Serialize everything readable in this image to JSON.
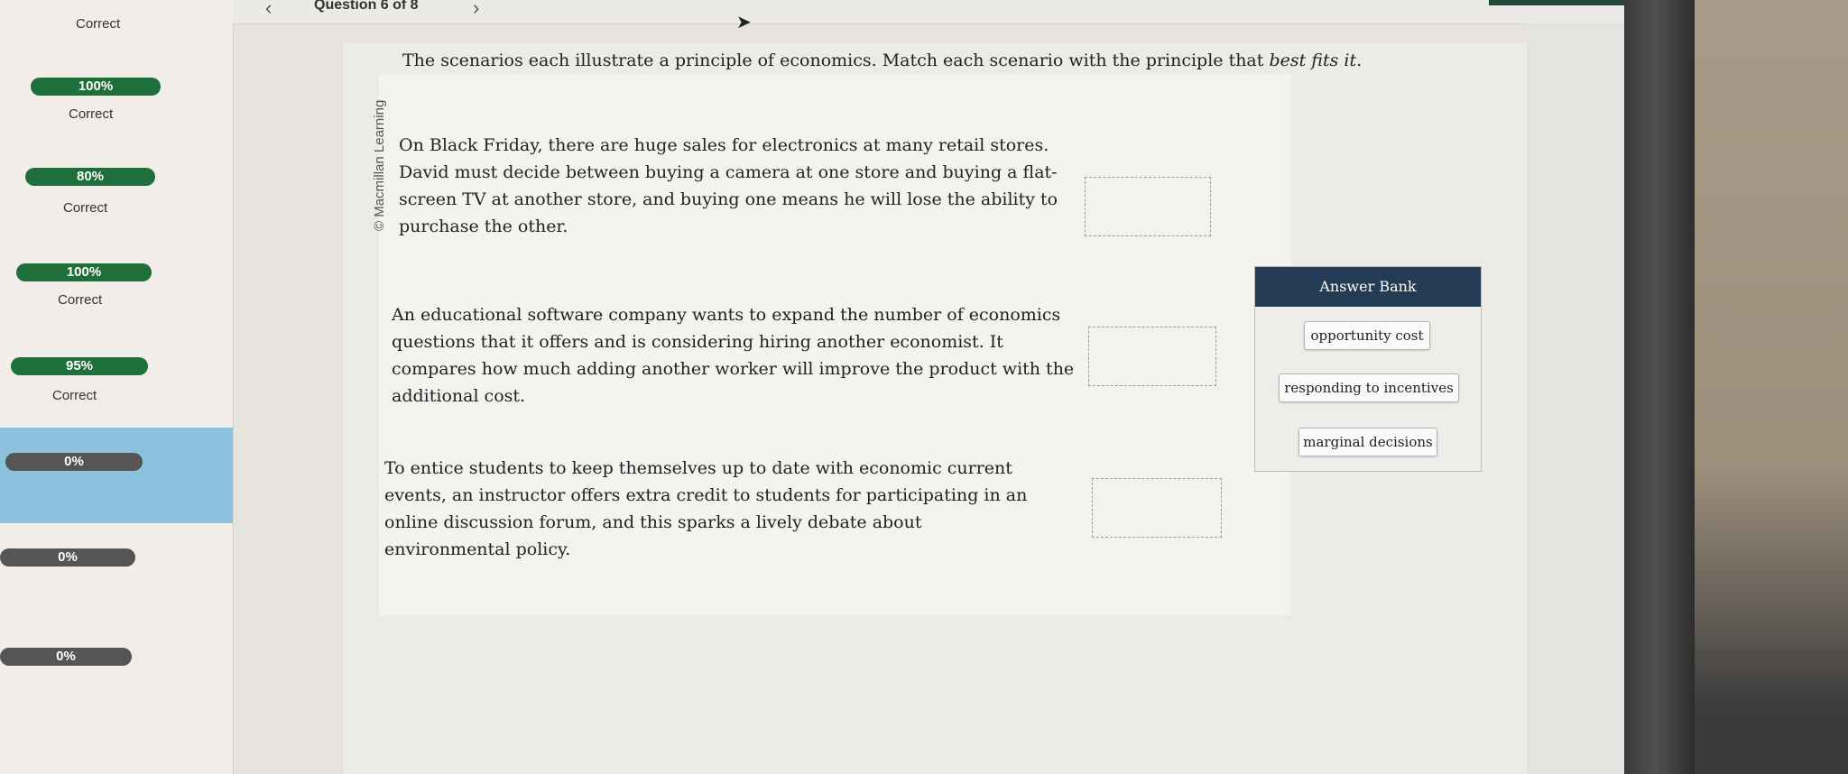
{
  "sidebar": {
    "items": [
      {
        "status": "Correct",
        "score": ""
      },
      {
        "status": "Correct",
        "score": "100%"
      },
      {
        "status": "Correct",
        "score": "80%"
      },
      {
        "status": "Correct",
        "score": "100%"
      },
      {
        "status": "Correct",
        "score": "95%"
      },
      {
        "status": "",
        "score": "0%"
      },
      {
        "status": "",
        "score": "0%"
      },
      {
        "status": "",
        "score": "0%"
      }
    ]
  },
  "header": {
    "question_counter": "Question 6 of 8",
    "prev_icon": "chevron-left-icon",
    "next_icon": "chevron-right-icon"
  },
  "question": {
    "credit": "© Macmillan Learning",
    "prompt_main": "The scenarios each illustrate a principle of economics. Match each scenario with the principle that ",
    "prompt_emph": "best fits it",
    "prompt_end": ".",
    "scenarios": [
      {
        "text": "On Black Friday, there are huge sales for electronics at many retail stores. David must decide between buying a camera at one store and buying a flat-screen TV at another store, and buying one means he will lose the ability to purchase the other."
      },
      {
        "text": "An educational software company wants to expand the number of economics questions that it offers and is considering hiring another economist. It compares how much adding another worker will improve the product with the additional cost."
      },
      {
        "text": "To entice students to keep themselves up to date with economic current events, an instructor offers extra credit to students for participating in an online discussion forum, and this sparks a lively debate about environmental policy."
      }
    ]
  },
  "answer_bank": {
    "title": "Answer Bank",
    "options": [
      "opportunity cost",
      "responding to incentives",
      "marginal decisions"
    ]
  },
  "colors": {
    "pill_green": "#1f6f3a",
    "pill_grey": "#555555",
    "active_item": "#8dc2df",
    "bank_header": "#243b54"
  }
}
